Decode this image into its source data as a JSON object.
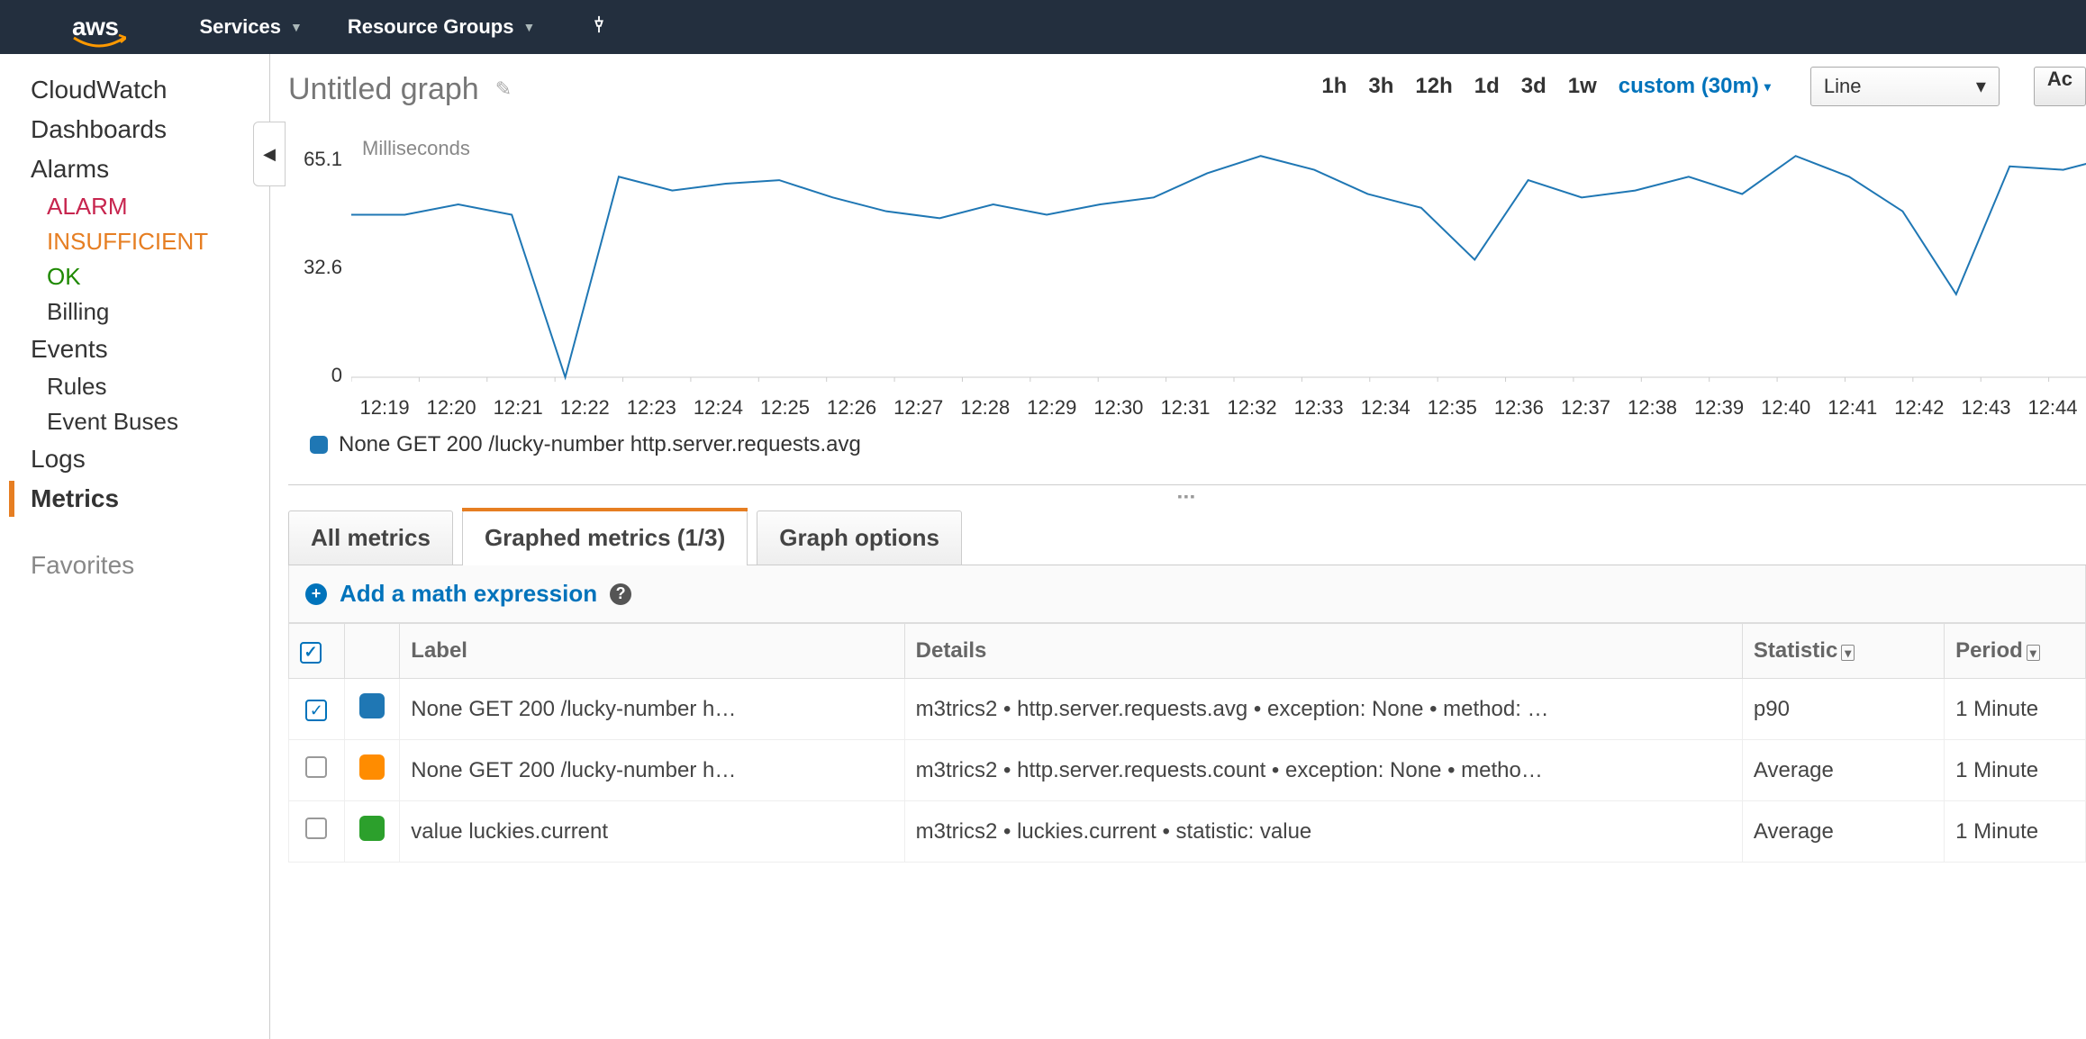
{
  "topnav": {
    "services": "Services",
    "resource_groups": "Resource Groups"
  },
  "sidebar": {
    "cloudwatch": "CloudWatch",
    "dashboards": "Dashboards",
    "alarms": "Alarms",
    "alarm": "ALARM",
    "insufficient": "INSUFFICIENT",
    "ok": "OK",
    "billing": "Billing",
    "events": "Events",
    "rules": "Rules",
    "event_buses": "Event Buses",
    "logs": "Logs",
    "metrics": "Metrics",
    "favorites": "Favorites"
  },
  "title": "Untitled graph",
  "ranges": {
    "r1h": "1h",
    "r3h": "3h",
    "r12h": "12h",
    "r1d": "1d",
    "r3d": "3d",
    "r1w": "1w",
    "custom": "custom (30m)"
  },
  "line_select": "Line",
  "action_btn": "Ac",
  "chart": {
    "yunit": "Milliseconds",
    "legend": "None GET 200 /lucky-number http.server.requests.avg"
  },
  "chart_data": {
    "type": "line",
    "title": "",
    "xlabel": "",
    "ylabel": "Milliseconds",
    "ylim": [
      0,
      65.1
    ],
    "y_ticks": [
      0,
      32.6,
      65.1
    ],
    "categories": [
      "12:19",
      "12:20",
      "12:21",
      "12:22",
      "12:23",
      "12:24",
      "12:25",
      "12:26",
      "12:27",
      "12:28",
      "12:29",
      "12:30",
      "12:31",
      "12:32",
      "12:33",
      "12:34",
      "12:35",
      "12:36",
      "12:37",
      "12:38",
      "12:39",
      "12:40",
      "12:41",
      "12:42",
      "12:43",
      "12:44"
    ],
    "series": [
      {
        "name": "None GET 200 /lucky-number http.server.requests.avg",
        "color": "#1f77b4",
        "values": [
          47,
          47,
          50,
          47,
          0,
          58,
          54,
          56,
          57,
          52,
          48,
          46,
          50,
          47,
          50,
          52,
          59,
          64,
          60,
          53,
          49,
          34,
          57,
          52,
          54,
          58,
          53,
          64,
          58,
          48,
          24,
          61,
          60,
          64
        ]
      }
    ]
  },
  "tabs": {
    "all": "All metrics",
    "graphed": "Graphed metrics (1/3)",
    "options": "Graph options"
  },
  "math_label": "Add a math expression",
  "table": {
    "headers": {
      "label": "Label",
      "details": "Details",
      "statistic": "Statistic",
      "period": "Period"
    },
    "rows": [
      {
        "checked": true,
        "color": "#1f77b4",
        "label": "None GET 200 /lucky-number h…",
        "details": "m3trics2 • http.server.requests.avg • exception: None • method: …",
        "statistic": "p90",
        "period": "1 Minute"
      },
      {
        "checked": false,
        "color": "#ff8c00",
        "label": "None GET 200 /lucky-number h…",
        "details": "m3trics2 • http.server.requests.count • exception: None • metho…",
        "statistic": "Average",
        "period": "1 Minute"
      },
      {
        "checked": false,
        "color": "#2ca02c",
        "label": "value luckies.current",
        "details": "m3trics2 • luckies.current • statistic: value",
        "statistic": "Average",
        "period": "1 Minute"
      }
    ]
  }
}
